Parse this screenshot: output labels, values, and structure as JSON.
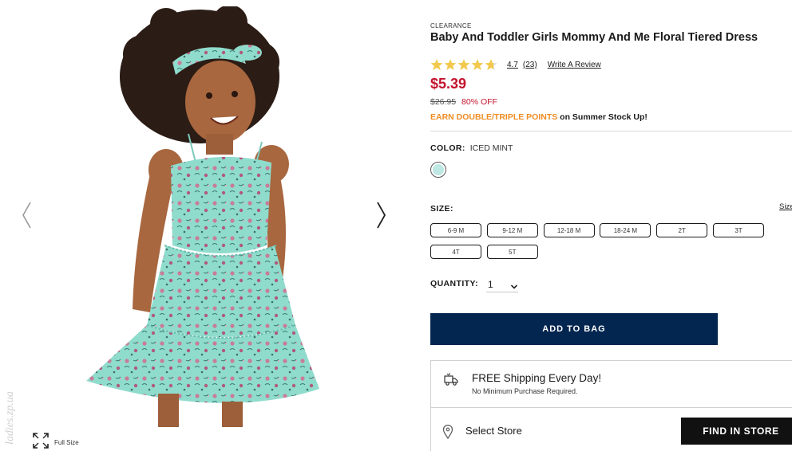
{
  "gallery": {
    "prev_icon": "chevron-left-icon",
    "next_icon": "chevron-right-icon",
    "full_size_icon": "expand-icon",
    "full_size_label": "Full Size",
    "watermark_text": "ladies.zp.ua"
  },
  "product": {
    "badge": "CLEARANCE",
    "title": "Baby And Toddler Girls Mommy And Me Floral Tiered Dress",
    "rating": {
      "value": "4.7",
      "stars_filled": 4.7,
      "stars_total": 5,
      "count": "(23)",
      "write_review": "Write A Review"
    },
    "price": "$5.39",
    "was_price": "$26.95",
    "discount": "80% OFF",
    "promo_highlight": "EARN DOUBLE/TRIPLE POINTS",
    "promo_rest": " on Summer Stock Up!"
  },
  "color": {
    "label": "COLOR:",
    "value": "ICED MINT",
    "swatch_hex": "#bde8e4"
  },
  "size": {
    "label": "SIZE:",
    "guide_label": "Size",
    "options": [
      "6-9 M",
      "9-12 M",
      "12-18 M",
      "18-24 M",
      "2T",
      "3T",
      "4T",
      "5T"
    ]
  },
  "quantity": {
    "label": "QUANTITY:",
    "value": "1"
  },
  "actions": {
    "add_to_bag": "ADD TO BAG"
  },
  "shipping": {
    "title": "FREE Shipping Every Day!",
    "subtitle": "No Minimum Purchase Required.",
    "select_store": "Select Store",
    "find_in_store": "FIND IN STORE"
  },
  "colors": {
    "price_red": "#c4132d",
    "promo_orange": "#ee8d24",
    "navy": "#032650",
    "star_gold": "#f2c94c",
    "dress_mint": "#8fdccd"
  }
}
